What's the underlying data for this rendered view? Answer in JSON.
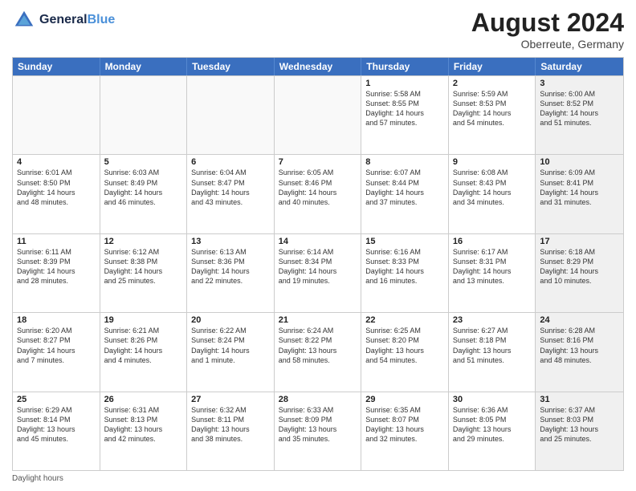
{
  "header": {
    "logo_line1": "General",
    "logo_line2": "Blue",
    "month_year": "August 2024",
    "location": "Oberreute, Germany"
  },
  "days": [
    "Sunday",
    "Monday",
    "Tuesday",
    "Wednesday",
    "Thursday",
    "Friday",
    "Saturday"
  ],
  "footer": "Daylight hours",
  "rows": [
    [
      {
        "day": "",
        "info": "",
        "empty": true
      },
      {
        "day": "",
        "info": "",
        "empty": true
      },
      {
        "day": "",
        "info": "",
        "empty": true
      },
      {
        "day": "",
        "info": "",
        "empty": true
      },
      {
        "day": "1",
        "info": "Sunrise: 5:58 AM\nSunset: 8:55 PM\nDaylight: 14 hours\nand 57 minutes."
      },
      {
        "day": "2",
        "info": "Sunrise: 5:59 AM\nSunset: 8:53 PM\nDaylight: 14 hours\nand 54 minutes."
      },
      {
        "day": "3",
        "info": "Sunrise: 6:00 AM\nSunset: 8:52 PM\nDaylight: 14 hours\nand 51 minutes.",
        "shaded": true
      }
    ],
    [
      {
        "day": "4",
        "info": "Sunrise: 6:01 AM\nSunset: 8:50 PM\nDaylight: 14 hours\nand 48 minutes."
      },
      {
        "day": "5",
        "info": "Sunrise: 6:03 AM\nSunset: 8:49 PM\nDaylight: 14 hours\nand 46 minutes."
      },
      {
        "day": "6",
        "info": "Sunrise: 6:04 AM\nSunset: 8:47 PM\nDaylight: 14 hours\nand 43 minutes."
      },
      {
        "day": "7",
        "info": "Sunrise: 6:05 AM\nSunset: 8:46 PM\nDaylight: 14 hours\nand 40 minutes."
      },
      {
        "day": "8",
        "info": "Sunrise: 6:07 AM\nSunset: 8:44 PM\nDaylight: 14 hours\nand 37 minutes."
      },
      {
        "day": "9",
        "info": "Sunrise: 6:08 AM\nSunset: 8:43 PM\nDaylight: 14 hours\nand 34 minutes."
      },
      {
        "day": "10",
        "info": "Sunrise: 6:09 AM\nSunset: 8:41 PM\nDaylight: 14 hours\nand 31 minutes.",
        "shaded": true
      }
    ],
    [
      {
        "day": "11",
        "info": "Sunrise: 6:11 AM\nSunset: 8:39 PM\nDaylight: 14 hours\nand 28 minutes."
      },
      {
        "day": "12",
        "info": "Sunrise: 6:12 AM\nSunset: 8:38 PM\nDaylight: 14 hours\nand 25 minutes."
      },
      {
        "day": "13",
        "info": "Sunrise: 6:13 AM\nSunset: 8:36 PM\nDaylight: 14 hours\nand 22 minutes."
      },
      {
        "day": "14",
        "info": "Sunrise: 6:14 AM\nSunset: 8:34 PM\nDaylight: 14 hours\nand 19 minutes."
      },
      {
        "day": "15",
        "info": "Sunrise: 6:16 AM\nSunset: 8:33 PM\nDaylight: 14 hours\nand 16 minutes."
      },
      {
        "day": "16",
        "info": "Sunrise: 6:17 AM\nSunset: 8:31 PM\nDaylight: 14 hours\nand 13 minutes."
      },
      {
        "day": "17",
        "info": "Sunrise: 6:18 AM\nSunset: 8:29 PM\nDaylight: 14 hours\nand 10 minutes.",
        "shaded": true
      }
    ],
    [
      {
        "day": "18",
        "info": "Sunrise: 6:20 AM\nSunset: 8:27 PM\nDaylight: 14 hours\nand 7 minutes."
      },
      {
        "day": "19",
        "info": "Sunrise: 6:21 AM\nSunset: 8:26 PM\nDaylight: 14 hours\nand 4 minutes."
      },
      {
        "day": "20",
        "info": "Sunrise: 6:22 AM\nSunset: 8:24 PM\nDaylight: 14 hours\nand 1 minute."
      },
      {
        "day": "21",
        "info": "Sunrise: 6:24 AM\nSunset: 8:22 PM\nDaylight: 13 hours\nand 58 minutes."
      },
      {
        "day": "22",
        "info": "Sunrise: 6:25 AM\nSunset: 8:20 PM\nDaylight: 13 hours\nand 54 minutes."
      },
      {
        "day": "23",
        "info": "Sunrise: 6:27 AM\nSunset: 8:18 PM\nDaylight: 13 hours\nand 51 minutes."
      },
      {
        "day": "24",
        "info": "Sunrise: 6:28 AM\nSunset: 8:16 PM\nDaylight: 13 hours\nand 48 minutes.",
        "shaded": true
      }
    ],
    [
      {
        "day": "25",
        "info": "Sunrise: 6:29 AM\nSunset: 8:14 PM\nDaylight: 13 hours\nand 45 minutes."
      },
      {
        "day": "26",
        "info": "Sunrise: 6:31 AM\nSunset: 8:13 PM\nDaylight: 13 hours\nand 42 minutes."
      },
      {
        "day": "27",
        "info": "Sunrise: 6:32 AM\nSunset: 8:11 PM\nDaylight: 13 hours\nand 38 minutes."
      },
      {
        "day": "28",
        "info": "Sunrise: 6:33 AM\nSunset: 8:09 PM\nDaylight: 13 hours\nand 35 minutes."
      },
      {
        "day": "29",
        "info": "Sunrise: 6:35 AM\nSunset: 8:07 PM\nDaylight: 13 hours\nand 32 minutes."
      },
      {
        "day": "30",
        "info": "Sunrise: 6:36 AM\nSunset: 8:05 PM\nDaylight: 13 hours\nand 29 minutes."
      },
      {
        "day": "31",
        "info": "Sunrise: 6:37 AM\nSunset: 8:03 PM\nDaylight: 13 hours\nand 25 minutes.",
        "shaded": true
      }
    ]
  ]
}
